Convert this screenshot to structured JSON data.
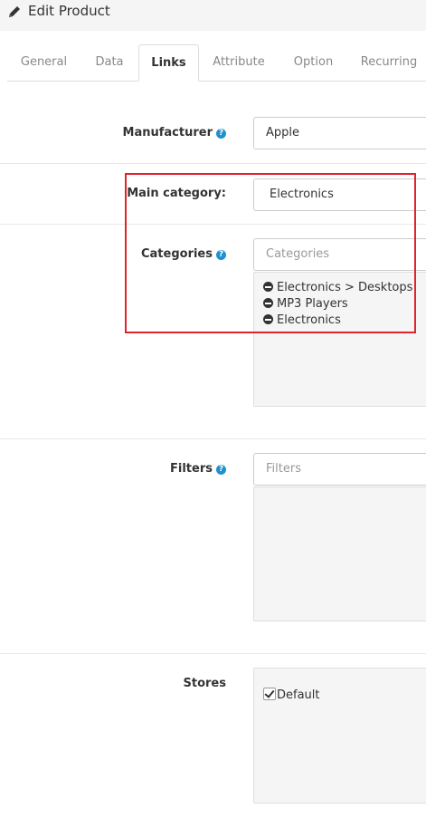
{
  "header": {
    "title": "Edit Product",
    "icon": "pencil-icon"
  },
  "tabs": [
    {
      "label": "General",
      "active": false
    },
    {
      "label": "Data",
      "active": false
    },
    {
      "label": "Links",
      "active": true
    },
    {
      "label": "Attribute",
      "active": false
    },
    {
      "label": "Option",
      "active": false
    },
    {
      "label": "Recurring",
      "active": false
    }
  ],
  "form": {
    "manufacturer": {
      "label": "Manufacturer",
      "value": "Apple",
      "help": "?"
    },
    "main_category": {
      "label": "Main category:",
      "value": "Electronics"
    },
    "categories": {
      "label": "Categories",
      "help": "?",
      "placeholder": "Categories",
      "items": [
        "Electronics > Desktops",
        "MP3 Players",
        "Electronics"
      ]
    },
    "filters": {
      "label": "Filters",
      "help": "?",
      "placeholder": "Filters",
      "items": []
    },
    "stores": {
      "label": "Stores",
      "items": [
        {
          "label": "Default",
          "checked": true
        }
      ]
    }
  },
  "colors": {
    "accent": "#1e91cf",
    "highlight": "#e0242b"
  }
}
